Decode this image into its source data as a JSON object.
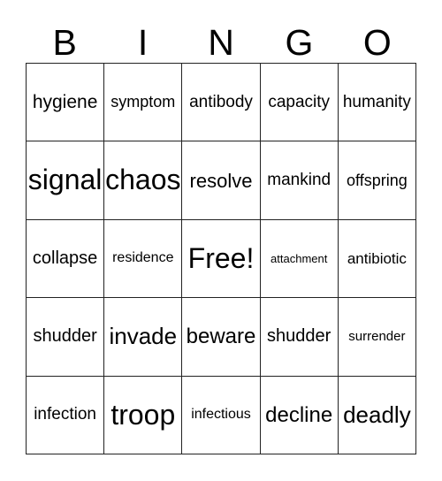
{
  "card": {
    "header_letters": [
      "B",
      "I",
      "N",
      "G",
      "O"
    ],
    "rows": [
      [
        {
          "text": "hygiene",
          "size": "fs-21"
        },
        {
          "text": "symptom",
          "size": "fs-18"
        },
        {
          "text": "antibody",
          "size": "fs-19"
        },
        {
          "text": "capacity",
          "size": "fs-19"
        },
        {
          "text": "humanity",
          "size": "fs-19"
        }
      ],
      [
        {
          "text": "signal",
          "size": "fs-32"
        },
        {
          "text": "chaos",
          "size": "fs-32"
        },
        {
          "text": "resolve",
          "size": "fs-22"
        },
        {
          "text": "mankind",
          "size": "fs-19"
        },
        {
          "text": "offspring",
          "size": "fs-18"
        }
      ],
      [
        {
          "text": "collapse",
          "size": "fs-20"
        },
        {
          "text": "residence",
          "size": "fs-16"
        },
        {
          "text": "Free!",
          "size": "fs-32"
        },
        {
          "text": "attachment",
          "size": "fs-13"
        },
        {
          "text": "antibiotic",
          "size": "fs-17"
        }
      ],
      [
        {
          "text": "shudder",
          "size": "fs-20"
        },
        {
          "text": "invade",
          "size": "fs-26"
        },
        {
          "text": "beware",
          "size": "fs-24"
        },
        {
          "text": "shudder",
          "size": "fs-20"
        },
        {
          "text": "surrender",
          "size": "fs-15"
        }
      ],
      [
        {
          "text": "infection",
          "size": "fs-19"
        },
        {
          "text": "troop",
          "size": "fs-32"
        },
        {
          "text": "infectious",
          "size": "fs-16"
        },
        {
          "text": "decline",
          "size": "fs-24"
        },
        {
          "text": "deadly",
          "size": "fs-26"
        }
      ]
    ],
    "colors": {
      "border": "#222222",
      "text": "#000000",
      "background": "#ffffff"
    }
  }
}
